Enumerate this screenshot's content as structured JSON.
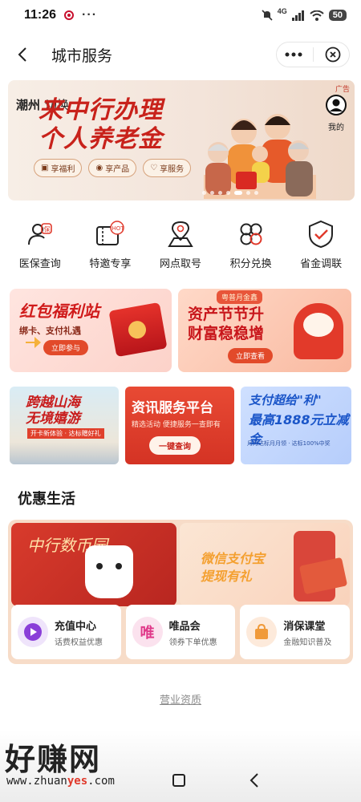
{
  "status": {
    "time": "11:26",
    "more": "···",
    "network": "4G",
    "battery": "50"
  },
  "nav": {
    "title": "城市服务"
  },
  "top_banner": {
    "city": "潮州",
    "switch": "切换",
    "ad_tag": "广告",
    "mine": "我的",
    "headline_line1": "来中行办理",
    "headline_line2": "个人养老金",
    "pills": [
      {
        "label": "享福利"
      },
      {
        "label": "享产品"
      },
      {
        "label": "享服务"
      }
    ]
  },
  "quick_services": [
    {
      "label": "医保查询",
      "icon": "medical-insurance-icon"
    },
    {
      "label": "特邀专享",
      "icon": "hot-ticket-icon"
    },
    {
      "label": "网点取号",
      "icon": "map-pin-icon"
    },
    {
      "label": "积分兑换",
      "icon": "clover-icon"
    },
    {
      "label": "省金调联",
      "icon": "shield-check-icon"
    }
  ],
  "promos": {
    "left": {
      "title": "红包福利站",
      "subtitle": "绑卡、支付礼遇",
      "button": "立即参与"
    },
    "right": {
      "tag": "粤普月金鑫",
      "title_line1": "资产节节升",
      "title_line2": "财富稳稳增",
      "button": "立即查看"
    }
  },
  "cards": {
    "a": {
      "title_line1": "跨越山海",
      "title_line2": "无境嬉游",
      "subtitle": "开卡新体验 · 达标赠好礼"
    },
    "b": {
      "title": "资讯服务平台",
      "subtitle": "精选活动 便捷服务一查即有",
      "button": "一键查询"
    },
    "c": {
      "title": "支付超给\"利\"",
      "amount": "最高1888元立减金",
      "subtitle": "月月达标月月领 · 达标100%中奖"
    }
  },
  "section": {
    "title": "优惠生活"
  },
  "life": {
    "banner_left": "中行数币园",
    "banner_right_line1": "微信支付宝",
    "banner_right_line2": "提现有礼",
    "services": [
      {
        "title": "充值中心",
        "subtitle": "话费权益优惠",
        "icon": "play-circle-icon",
        "glyph": ""
      },
      {
        "title": "唯品会",
        "subtitle": "领券下单优惠",
        "icon": "vip-shop-icon",
        "glyph": "唯"
      },
      {
        "title": "消保课堂",
        "subtitle": "金融知识普及",
        "icon": "bag-icon",
        "glyph": ""
      }
    ]
  },
  "footer": {
    "license": "营业资质"
  },
  "watermark": {
    "brand": "好赚网",
    "url_prefix": "www.zhuan",
    "url_highlight": "yes",
    "url_suffix": ".com"
  },
  "colors": {
    "brand_red": "#c8221b",
    "accent_orange": "#e24a2a",
    "panel_peach": "#f7dcc8"
  }
}
